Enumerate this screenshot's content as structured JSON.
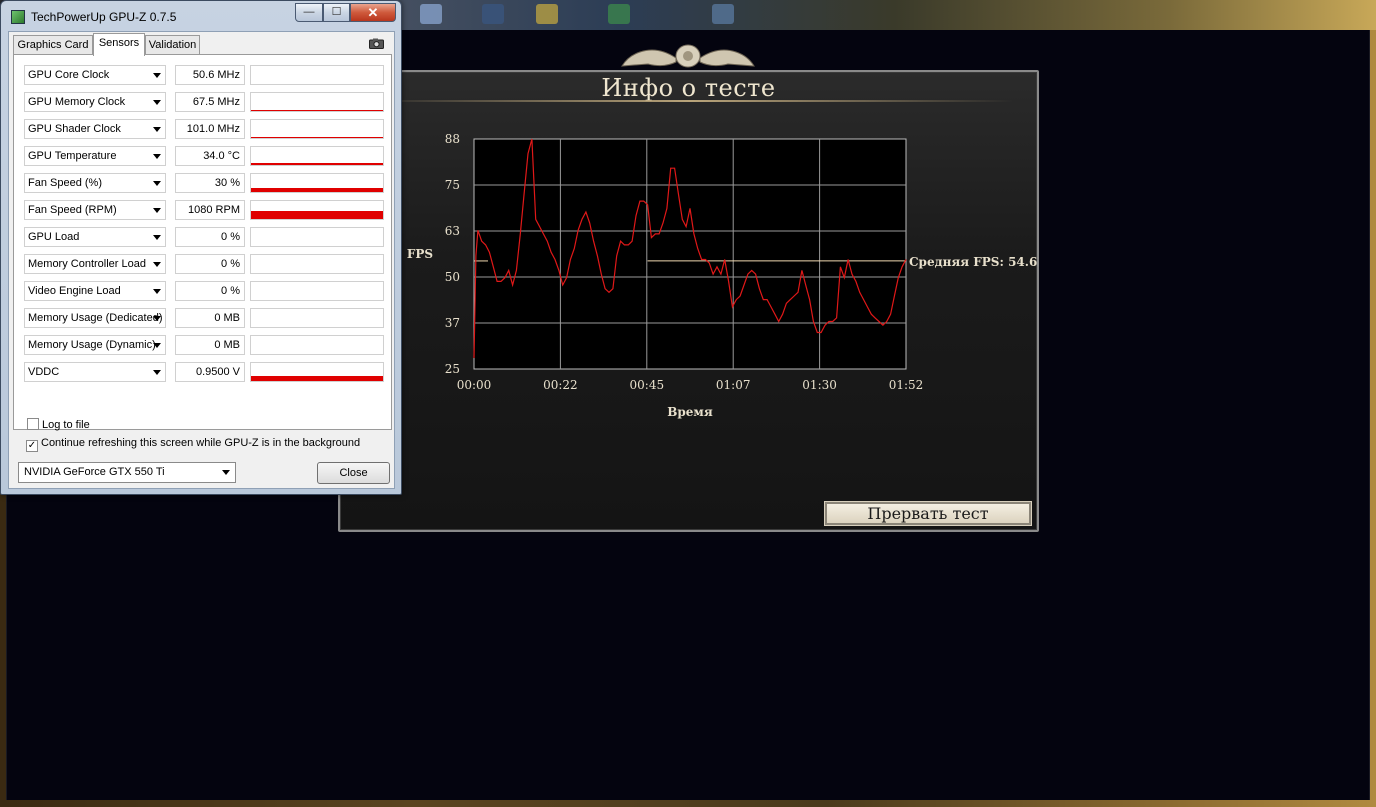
{
  "gpuz": {
    "title": "TechPowerUp GPU-Z 0.7.5",
    "tabs": [
      {
        "label": "Graphics Card",
        "active": false
      },
      {
        "label": "Sensors",
        "active": true
      },
      {
        "label": "Validation",
        "active": false
      }
    ],
    "sensors": [
      {
        "name": "GPU Core Clock",
        "value": "50.6 MHz",
        "level": 0.0
      },
      {
        "name": "GPU Memory Clock",
        "value": "67.5 MHz",
        "level": 0.04
      },
      {
        "name": "GPU Shader Clock",
        "value": "101.0 MHz",
        "level": 0.04
      },
      {
        "name": "GPU Temperature",
        "value": "34.0 °C",
        "level": 0.1
      },
      {
        "name": "Fan Speed (%)",
        "value": "30 %",
        "level": 0.2
      },
      {
        "name": "Fan Speed (RPM)",
        "value": "1080 RPM",
        "level": 0.45
      },
      {
        "name": "GPU Load",
        "value": "0 %",
        "level": 0.0
      },
      {
        "name": "Memory Controller Load",
        "value": "0 %",
        "level": 0.0
      },
      {
        "name": "Video Engine Load",
        "value": "0 %",
        "level": 0.0
      },
      {
        "name": "Memory Usage (Dedicated)",
        "value": "0 MB",
        "level": 0.0
      },
      {
        "name": "Memory Usage (Dynamic)",
        "value": "0 MB",
        "level": 0.0
      },
      {
        "name": "VDDC",
        "value": "0.9500 V",
        "level": 0.3
      }
    ],
    "log_to_file": {
      "label": "Log to file",
      "checked": false
    },
    "continue_refreshing": {
      "label": "Continue refreshing this screen while GPU-Z is in the background",
      "checked": true
    },
    "gpu_select": "NVIDIA GeForce GTX 550 Ti",
    "close_label": "Close"
  },
  "test_panel": {
    "title": "Инфо о тесте",
    "abort_label": "Прервать тест"
  },
  "chart_data": {
    "type": "line",
    "title": "",
    "xlabel": "Время",
    "ylabel": "FPS",
    "x_ticks": [
      "00:00",
      "00:22",
      "00:45",
      "01:07",
      "01:30",
      "01:52"
    ],
    "y_ticks": [
      25,
      37,
      50,
      63,
      75,
      88
    ],
    "xlim": [
      0,
      112
    ],
    "ylim": [
      25,
      88
    ],
    "grid": true,
    "average_label": "Средняя FPS: 54.6",
    "average_value": 54.6,
    "series": [
      {
        "color": "#e01818",
        "x": [
          0,
          0.5,
          1,
          2,
          3,
          4,
          5,
          6,
          7,
          8,
          9,
          10,
          11,
          12,
          13,
          14,
          15,
          16,
          17,
          18,
          19,
          20,
          21,
          22,
          23,
          24,
          25,
          26,
          27,
          28,
          29,
          30,
          31,
          32,
          33,
          34,
          35,
          36,
          37,
          38,
          39,
          40,
          41,
          42,
          43,
          44,
          45,
          46,
          47,
          48,
          49,
          50,
          51,
          52,
          53,
          54,
          55,
          56,
          57,
          58,
          59,
          60,
          61,
          62,
          63,
          64,
          65,
          66,
          67,
          68,
          69,
          70,
          71,
          72,
          73,
          74,
          75,
          76,
          77,
          78,
          79,
          80,
          81,
          82,
          83,
          84,
          85,
          86,
          87,
          88,
          89,
          90,
          91,
          92,
          93,
          94,
          95,
          96,
          97,
          98,
          99,
          100,
          101,
          102,
          103,
          104,
          105,
          106,
          107,
          108,
          109,
          110,
          111,
          112
        ],
        "y": [
          28,
          56,
          63,
          60,
          59,
          57,
          53,
          49,
          49,
          50,
          52,
          48,
          52,
          62,
          73,
          84,
          88,
          66,
          64,
          62,
          60,
          57,
          55,
          52,
          48,
          50,
          55,
          58,
          63,
          66,
          68,
          65,
          60,
          56,
          51,
          47,
          46,
          47,
          56,
          60,
          59,
          59,
          60,
          67,
          71,
          71,
          70,
          61,
          62,
          62,
          65,
          69,
          80,
          80,
          73,
          66,
          64,
          69,
          62,
          58,
          55,
          55,
          54,
          51,
          53,
          51,
          55,
          49,
          42,
          44,
          45,
          48,
          51,
          52,
          51,
          47,
          44,
          44,
          42,
          40,
          38,
          40,
          43,
          44,
          45,
          46,
          52,
          48,
          44,
          38,
          35,
          35,
          37,
          38,
          38,
          39,
          53,
          50,
          55,
          51,
          49,
          46,
          44,
          42,
          40,
          39,
          38,
          37,
          38,
          40,
          45,
          50,
          53,
          55
        ]
      }
    ]
  }
}
